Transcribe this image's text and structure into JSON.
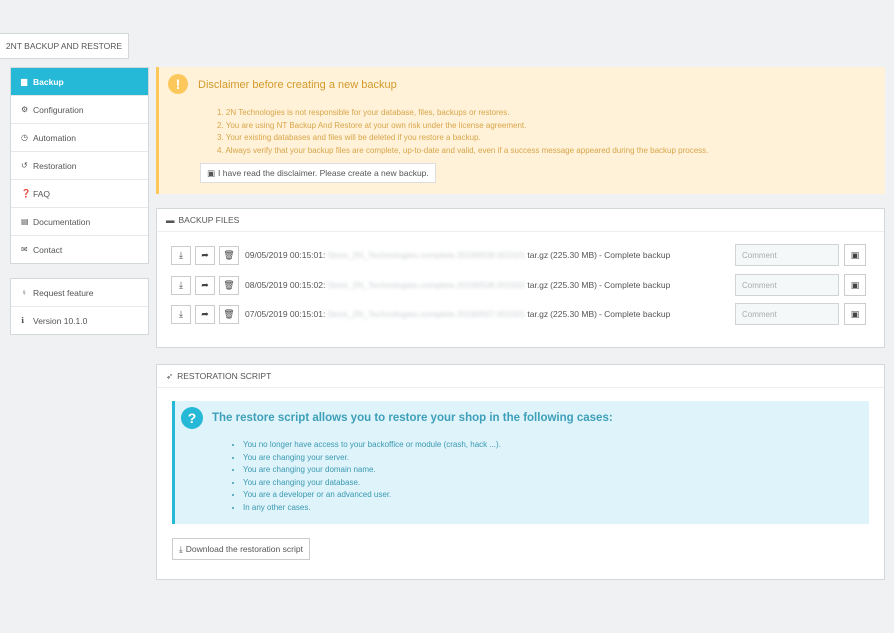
{
  "module_tab": "2NT BACKUP AND RESTORE",
  "sidebar": {
    "items": [
      {
        "label": "Backup",
        "icon": "backup-icon",
        "glyph": "▆"
      },
      {
        "label": "Configuration",
        "icon": "cogs-icon",
        "glyph": "⚙"
      },
      {
        "label": "Automation",
        "icon": "clock-icon",
        "glyph": "◷"
      },
      {
        "label": "Restoration",
        "icon": "history-icon",
        "glyph": "↺"
      },
      {
        "label": "FAQ",
        "icon": "question-icon",
        "glyph": "❓"
      },
      {
        "label": "Documentation",
        "icon": "book-icon",
        "glyph": "▤"
      },
      {
        "label": "Contact",
        "icon": "envelope-icon",
        "glyph": "✉"
      }
    ],
    "extra": [
      {
        "label": "Request feature",
        "icon": "lightbulb-icon",
        "glyph": "♀"
      },
      {
        "label": "Version 10.1.0",
        "icon": "info-icon",
        "glyph": "ℹ"
      }
    ]
  },
  "disclaimer": {
    "title": "Disclaimer before creating a new backup",
    "items": [
      "1. 2N Technologies is not responsible for your database, files, backups or restores.",
      "2. You are using NT Backup And Restore at your own risk under the license agreement.",
      "3. Your existing databases and files will be deleted if you restore a backup.",
      "4. Always verify that your backup files are complete, up-to-date and valid, even if a success message appeared during the backup process."
    ],
    "button_label": "I have read the disclaimer. Please create a new backup."
  },
  "backup_files": {
    "title": "BACKUP FILES",
    "rows": [
      {
        "date": "09/05/2019 00:15:01:",
        "name": "Store_2N_Technologies.complete.20190509.001501",
        "ext": "tar.gz",
        "size": "(225.30 MB)",
        "type": "- Complete backup",
        "comment_placeholder": "Comment"
      },
      {
        "date": "08/05/2019 00:15:02:",
        "name": "Store_2N_Technologies.complete.20190508.001502",
        "ext": "tar.gz",
        "size": "(225.30 MB)",
        "type": "- Complete backup",
        "comment_placeholder": "Comment"
      },
      {
        "date": "07/05/2019 00:15:01:",
        "name": "Store_2N_Technologies.complete.20190507.001501",
        "ext": "tar.gz",
        "size": "(225.30 MB)",
        "type": "- Complete backup",
        "comment_placeholder": "Comment"
      }
    ]
  },
  "restoration": {
    "title": "RESTORATION SCRIPT",
    "info_title": "The restore script allows you to restore your shop in the following cases:",
    "cases": [
      "You no longer have access to your backoffice or module (crash, hack ...).",
      "You are changing your server.",
      "You are changing your domain name.",
      "You are changing your database.",
      "You are a developer or an advanced user.",
      "In any other cases."
    ],
    "download_label": "Download the restoration script"
  },
  "colors": {
    "accent": "#25b9d7",
    "warning": "#fcc85c",
    "warning_bg": "#fff2d9",
    "info_bg": "#dff4fa"
  }
}
